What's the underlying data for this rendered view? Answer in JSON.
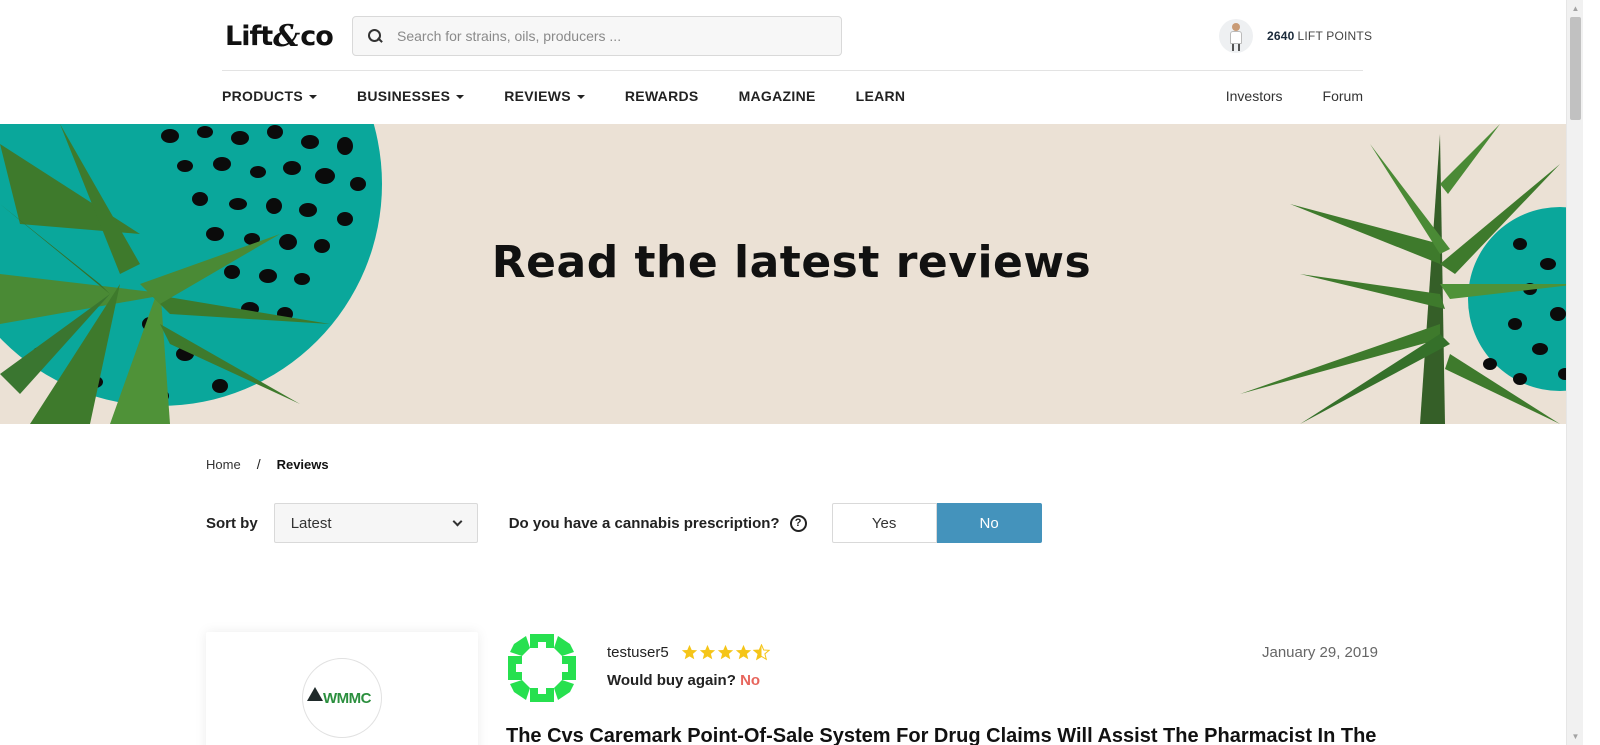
{
  "header": {
    "logo_text_1": "Lift",
    "logo_amp": "&",
    "logo_text_2": "co",
    "search_placeholder": "Search for strains, oils, producers ...",
    "points_value": "2640",
    "points_label": "LIFT POINTS"
  },
  "nav": {
    "items": [
      {
        "label": "PRODUCTS",
        "dropdown": true
      },
      {
        "label": "BUSINESSES",
        "dropdown": true
      },
      {
        "label": "REVIEWS",
        "dropdown": true
      },
      {
        "label": "REWARDS",
        "dropdown": false
      },
      {
        "label": "MAGAZINE",
        "dropdown": false
      },
      {
        "label": "LEARN",
        "dropdown": false
      }
    ],
    "right": [
      {
        "label": "Investors"
      },
      {
        "label": "Forum"
      }
    ]
  },
  "hero": {
    "title": "Read the latest reviews",
    "colors": {
      "background": "#ebe1d5",
      "teal": "#0aa79b",
      "leaf": "#3e7a2c"
    }
  },
  "breadcrumb": {
    "home": "Home",
    "separator": "/",
    "current": "Reviews"
  },
  "filters": {
    "sort_label": "Sort by",
    "sort_value": "Latest",
    "prescription_question": "Do you have a cannabis prescription?",
    "help_icon": "?",
    "yes_label": "Yes",
    "no_label": "No",
    "selected": "No",
    "accent_color": "#4493bc"
  },
  "review": {
    "product_logo_text": "WMMC",
    "reviewer": "testuser5",
    "rating": 4.5,
    "would_buy_label": "Would buy again?",
    "would_buy_value": "No",
    "date": "January 29, 2019",
    "title": "The Cvs Caremark Point-Of-Sale System For Drug Claims Will Assist The Pharmacist In The"
  }
}
